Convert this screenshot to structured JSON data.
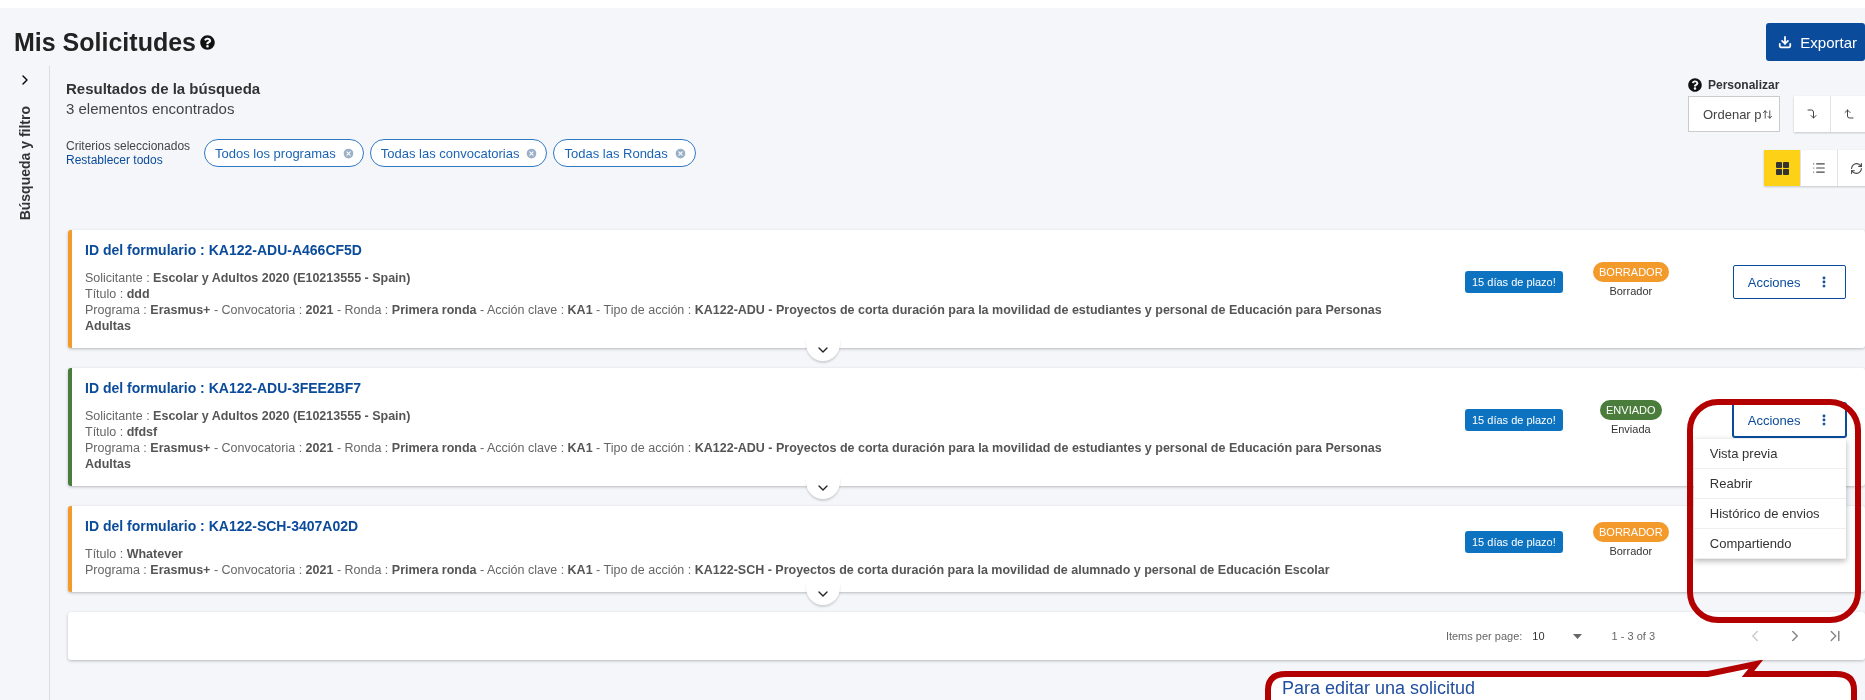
{
  "page": {
    "title": "Mis Solicitudes",
    "export_button": "Exportar"
  },
  "sidebar": {
    "label": "Búsqueda y filtro",
    "expanded": false
  },
  "results": {
    "heading": "Resultados de la búsqueda",
    "count": "3 elementos encontrados"
  },
  "criteria": {
    "label": "Criterios seleccionados",
    "reset_link": "Restablecer todos",
    "chips": [
      "Todos los programas",
      "Todas las convocatorias",
      "Todas las Rondas"
    ]
  },
  "customize": {
    "label": "Personalizar",
    "sort_placeholder": "Ordenar p"
  },
  "views": [
    {
      "kind": "grid",
      "selected": true
    },
    {
      "kind": "list",
      "selected": false
    }
  ],
  "applications": [
    {
      "id_label": "ID del formulario : KA122-ADU-A466CF5D",
      "lines": [
        "Solicitante : **Escolar y Adultos 2020 (E10213555 - Spain)**",
        "Título : **ddd**",
        "Programa : **Erasmus+** - Convocatoria : **2021** - Ronda : **Primera ronda** - Acción clave : **KA1** - Tipo de acción : **KA122-ADU - Proyectos de corta duración para la movilidad de estudiantes y personal de Educación para Personas Adultas**"
      ],
      "deadline": "15 días de plazo!",
      "status": "BORRADOR",
      "kind": "draft",
      "status_note": "Borrador",
      "actions": "Acciones",
      "menu_open": false
    },
    {
      "id_label": "ID del formulario : KA122-ADU-3FEE2BF7",
      "lines": [
        "Solicitante : **Escolar y Adultos 2020 (E10213555 - Spain)**",
        "Título : **dfdsf**",
        "Programa : **Erasmus+** - Convocatoria : **2021** - Ronda : **Primera ronda** - Acción clave : **KA1** - Tipo de acción : **KA122-ADU - Proyectos de corta duración para la movilidad de estudiantes y personal de Educación para Personas Adultas**"
      ],
      "deadline": "15 días de plazo!",
      "status": "ENVIADO",
      "kind": "sent",
      "status_note": "Enviada",
      "actions": "Acciones",
      "menu_open": true
    },
    {
      "id_label": "ID del formulario : KA122-SCH-3407A02D",
      "lines": [
        "Título : **Whatever**",
        "Programa : **Erasmus+** - Convocatoria : **2021** - Ronda : **Primera ronda** - Acción clave : **KA1** - Tipo de acción : **KA122-SCH - Proyectos de corta duración para la movilidad de alumnado y personal de Educación Escolar**"
      ],
      "deadline": "15 días de plazo!",
      "status": "BORRADOR",
      "kind": "draft",
      "status_note": "Borrador"
    }
  ],
  "actions_menu": [
    "Vista previa",
    "Reabrir",
    "Histórico de envios",
    "Compartiendo"
  ],
  "pagination": {
    "items_per_page_label": "Items per page:",
    "page_size": "10",
    "range": "1 - 3 of 3"
  },
  "annotation": {
    "text": "Para editar una solicitud"
  }
}
